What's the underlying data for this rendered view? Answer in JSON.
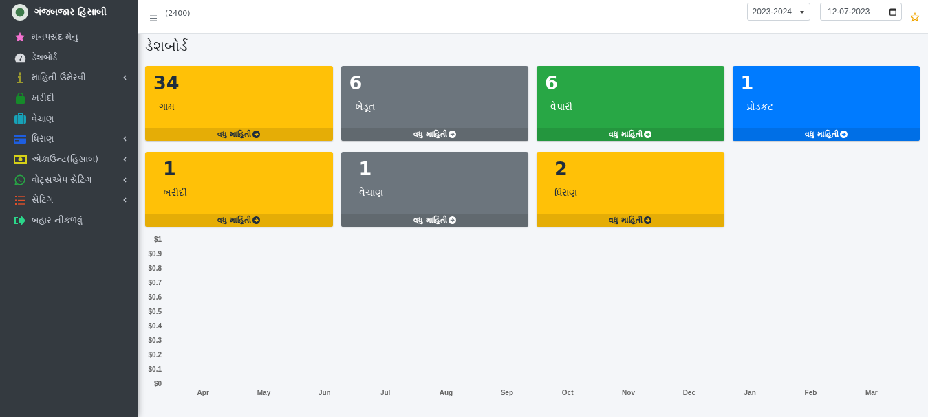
{
  "sidebar": {
    "brand": "ગંજબજાર હિસાબી",
    "items": [
      {
        "kind": "star",
        "label": "મનપસંદ મેનુ",
        "expandable": false
      },
      {
        "kind": "gauge",
        "label": "ડેશબોર્ડ",
        "expandable": false
      },
      {
        "kind": "info",
        "label": "માહિતી ઉમેરવી",
        "expandable": true
      },
      {
        "kind": "bag",
        "label": "ખરીદી",
        "expandable": false
      },
      {
        "kind": "suitcase",
        "label": "વેચાણ",
        "expandable": false
      },
      {
        "kind": "card",
        "label": "ધિરાણ",
        "expandable": true
      },
      {
        "kind": "money",
        "label": "એકાઉન્ટ(હિસાબ)",
        "expandable": true
      },
      {
        "kind": "whatsapp",
        "label": "વોટ્સએપ સેટિંગ",
        "expandable": true
      },
      {
        "kind": "list",
        "label": "સેટિંગ",
        "expandable": true
      },
      {
        "kind": "logout",
        "label": "બહાર નીકળવું",
        "expandable": false
      }
    ]
  },
  "header": {
    "code": "(2400)",
    "year_select": "2023-2024",
    "date_field": "12-07-2023"
  },
  "page_title": "ડેશબોર્ડ",
  "cards": [
    {
      "kind": "warning",
      "value": "34",
      "label": "ગામ",
      "link": "વધુ માહિતી"
    },
    {
      "kind": "secondary",
      "value": "6",
      "label": "ખેડૂત",
      "link": "વધુ માહિતી"
    },
    {
      "kind": "success",
      "value": "6",
      "label": "વેપારી",
      "link": "વધુ માહિતી"
    },
    {
      "kind": "primary",
      "value": "1",
      "label": "પ્રોડકટ",
      "link": "વધુ માહિતી"
    },
    {
      "kind": "warning",
      "value": "1",
      "label": "ખરીદી",
      "link": "વધુ માહિતી"
    },
    {
      "kind": "secondary",
      "value": "1",
      "label": "વેચાણ",
      "link": "વધુ માહિતી"
    },
    {
      "kind": "warning",
      "value": "2",
      "label": "ધિરાણ",
      "link": "વધુ માહિતી"
    }
  ],
  "chart": {
    "chart_data": {
      "type": "bar",
      "categories": [
        "Apr",
        "May",
        "Jun",
        "Jul",
        "Aug",
        "Sep",
        "Oct",
        "Nov",
        "Dec",
        "Jan",
        "Feb",
        "Mar"
      ],
      "ylim": [
        0,
        1
      ],
      "yticks": [
        {
          "value": 0,
          "label": "$0"
        },
        {
          "value": 0.1,
          "label": "$0.1"
        },
        {
          "value": 0.2,
          "label": "$0.2"
        },
        {
          "value": 0.3,
          "label": "$0.3"
        },
        {
          "value": 0.4,
          "label": "$0.4"
        },
        {
          "value": 0.5,
          "label": "$0.5"
        },
        {
          "value": 0.6,
          "label": "$0.6"
        },
        {
          "value": 0.7,
          "label": "$0.7"
        },
        {
          "value": 0.8,
          "label": "$0.8"
        },
        {
          "value": 0.9,
          "label": "$0.9"
        },
        {
          "value": 1,
          "label": "$1"
        }
      ],
      "values": [
        null,
        null,
        null,
        null,
        null,
        null,
        null,
        null,
        null,
        null,
        null,
        null
      ]
    }
  }
}
